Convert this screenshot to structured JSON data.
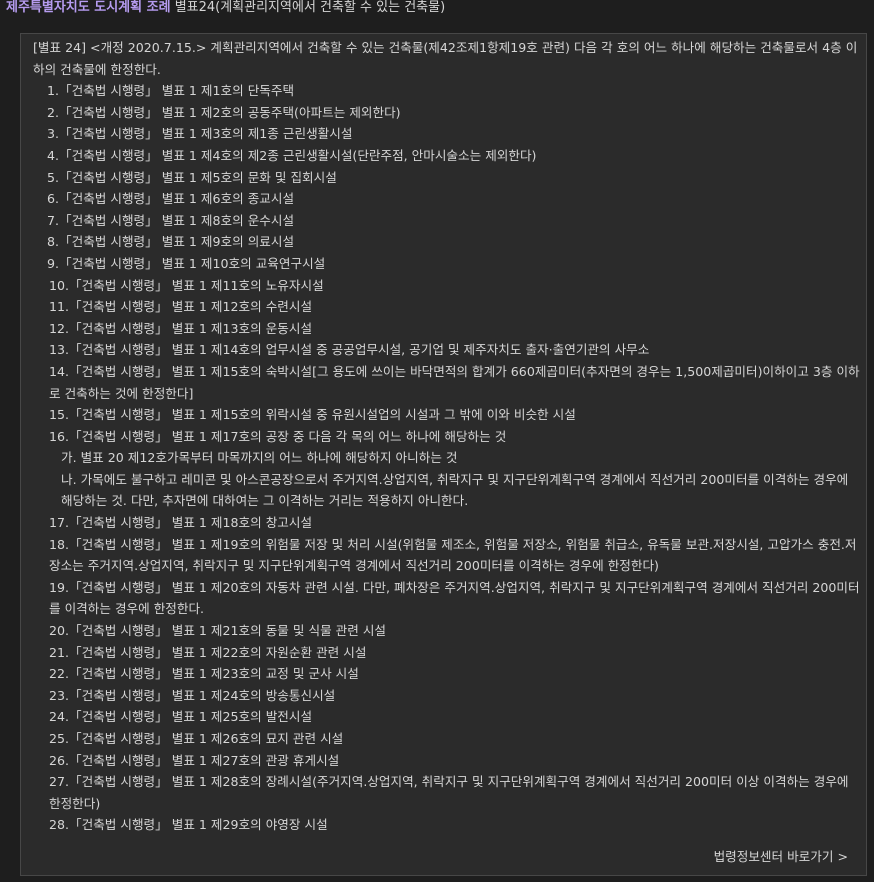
{
  "header": {
    "link_text": "제주특별자치도 도시계획 조례",
    "title_rest": "별표24(계획관리지역에서 건축할 수 있는 건축물)"
  },
  "intro": "[별표 24] <개정 2020.7.15.> 계획관리지역에서 건축할 수 있는 건축물(제42조제1항제19호 관련) 다음 각 호의 어느 하나에 해당하는 건축물로서 4층 이하의 건축물에 한정한다.",
  "items": [
    {
      "num": "1.",
      "text": "「건축법 시행령」 별표 1 제1호의 단독주택"
    },
    {
      "num": "2.",
      "text": "「건축법 시행령」 별표 1 제2호의 공동주택(아파트는 제외한다)"
    },
    {
      "num": "3.",
      "text": "「건축법 시행령」 별표 1 제3호의 제1종 근린생활시설"
    },
    {
      "num": "4.",
      "text": "「건축법 시행령」 별표 1 제4호의 제2종 근린생활시설(단란주점, 안마시술소는 제외한다)"
    },
    {
      "num": "5.",
      "text": "「건축법 시행령」 별표 1 제5호의 문화 및 집회시설"
    },
    {
      "num": "6.",
      "text": "「건축법 시행령」 별표 1 제6호의 종교시설"
    },
    {
      "num": "7.",
      "text": "「건축법 시행령」 별표 1 제8호의 운수시설"
    },
    {
      "num": "8.",
      "text": "「건축법 시행령」 별표 1 제9호의 의료시설"
    },
    {
      "num": "9.",
      "text": "「건축법 시행령」 별표 1 제10호의 교육연구시설"
    },
    {
      "num": "10.",
      "text": "「건축법 시행령」 별표 1 제11호의 노유자시설"
    },
    {
      "num": "11.",
      "text": "「건축법 시행령」 별표 1 제12호의 수련시설"
    },
    {
      "num": "12.",
      "text": "「건축법 시행령」 별표 1 제13호의 운동시설"
    },
    {
      "num": "13.",
      "text": "「건축법 시행령」 별표 1 제14호의 업무시설 중 공공업무시설, 공기업 및 제주자치도 출자·출연기관의 사무소"
    },
    {
      "num": "14.",
      "text": "「건축법 시행령」 별표 1 제15호의 숙박시설[그 용도에 쓰이는 바닥면적의 합계가 660제곱미터(추자면의 경우는 1,500제곱미터)이하이고 3층 이하로 건축하는 것에 한정한다]"
    },
    {
      "num": "15.",
      "text": "「건축법 시행령」 별표 1 제15호의 위락시설 중 유원시설업의 시설과 그 밖에 이와 비슷한 시설"
    },
    {
      "num": "16.",
      "text": "「건축법 시행령」 별표 1 제17호의 공장 중 다음 각 목의 어느 하나에 해당하는 것"
    },
    {
      "num": "17.",
      "text": "「건축법 시행령」 별표 1 제18호의 창고시설"
    },
    {
      "num": "18.",
      "text": "「건축법 시행령」 별표 1 제19호의 위험물 저장 및 처리 시설(위험물 제조소, 위험물 저장소, 위험물 취급소, 유독물 보관.저장시설, 고압가스 충전.저장소는 주거지역.상업지역, 취락지구 및 지구단위계획구역 경계에서 직선거리 200미터를 이격하는 경우에 한정한다)"
    },
    {
      "num": "19.",
      "text": "「건축법 시행령」 별표 1 제20호의 자동차 관련 시설. 다만, 폐차장은 주거지역.상업지역, 취락지구 및 지구단위계획구역 경계에서 직선거리 200미터를 이격하는 경우에 한정한다."
    },
    {
      "num": "20.",
      "text": "「건축법 시행령」 별표 1 제21호의 동물 및 식물 관련 시설"
    },
    {
      "num": "21.",
      "text": "「건축법 시행령」 별표 1 제22호의 자원순환 관련 시설"
    },
    {
      "num": "22.",
      "text": "「건축법 시행령」 별표 1 제23호의 교정 및 군사 시설"
    },
    {
      "num": "23.",
      "text": "「건축법 시행령」 별표 1 제24호의 방송통신시설"
    },
    {
      "num": "24.",
      "text": "「건축법 시행령」 별표 1 제25호의 발전시설"
    },
    {
      "num": "25.",
      "text": "「건축법 시행령」 별표 1 제26호의 묘지 관련 시설"
    },
    {
      "num": "26.",
      "text": "「건축법 시행령」 별표 1 제27호의 관광 휴게시설"
    },
    {
      "num": "27.",
      "text": "「건축법 시행령」 별표 1 제28호의 장례시설(주거지역.상업지역, 취락지구 및 지구단위계획구역 경계에서 직선거리 200미터 이상 이격하는 경우에 한정한다)"
    },
    {
      "num": "28.",
      "text": "「건축법 시행령」 별표 1 제29호의 야영장 시설"
    }
  ],
  "sub_items_16": [
    {
      "text": "가. 별표 20 제12호가목부터 마목까지의 어느 하나에 해당하지 아니하는 것"
    },
    {
      "text": "나. 가목에도 불구하고 레미콘 및 아스콘공장으로서 주거지역.상업지역, 취락지구 및 지구단위계획구역 경계에서 직선거리 200미터를 이격하는 경우에 해당하는 것. 다만, 추자면에 대하여는 그 이격하는 거리는 적용하지 아니한다."
    }
  ],
  "footer": {
    "link_text": "법령정보센터 바로가기 >"
  },
  "colors": {
    "background": "#1e1e1e",
    "panel": "#2b2b2b",
    "accent": "#b69cf0",
    "text": "#d6d6d6"
  }
}
